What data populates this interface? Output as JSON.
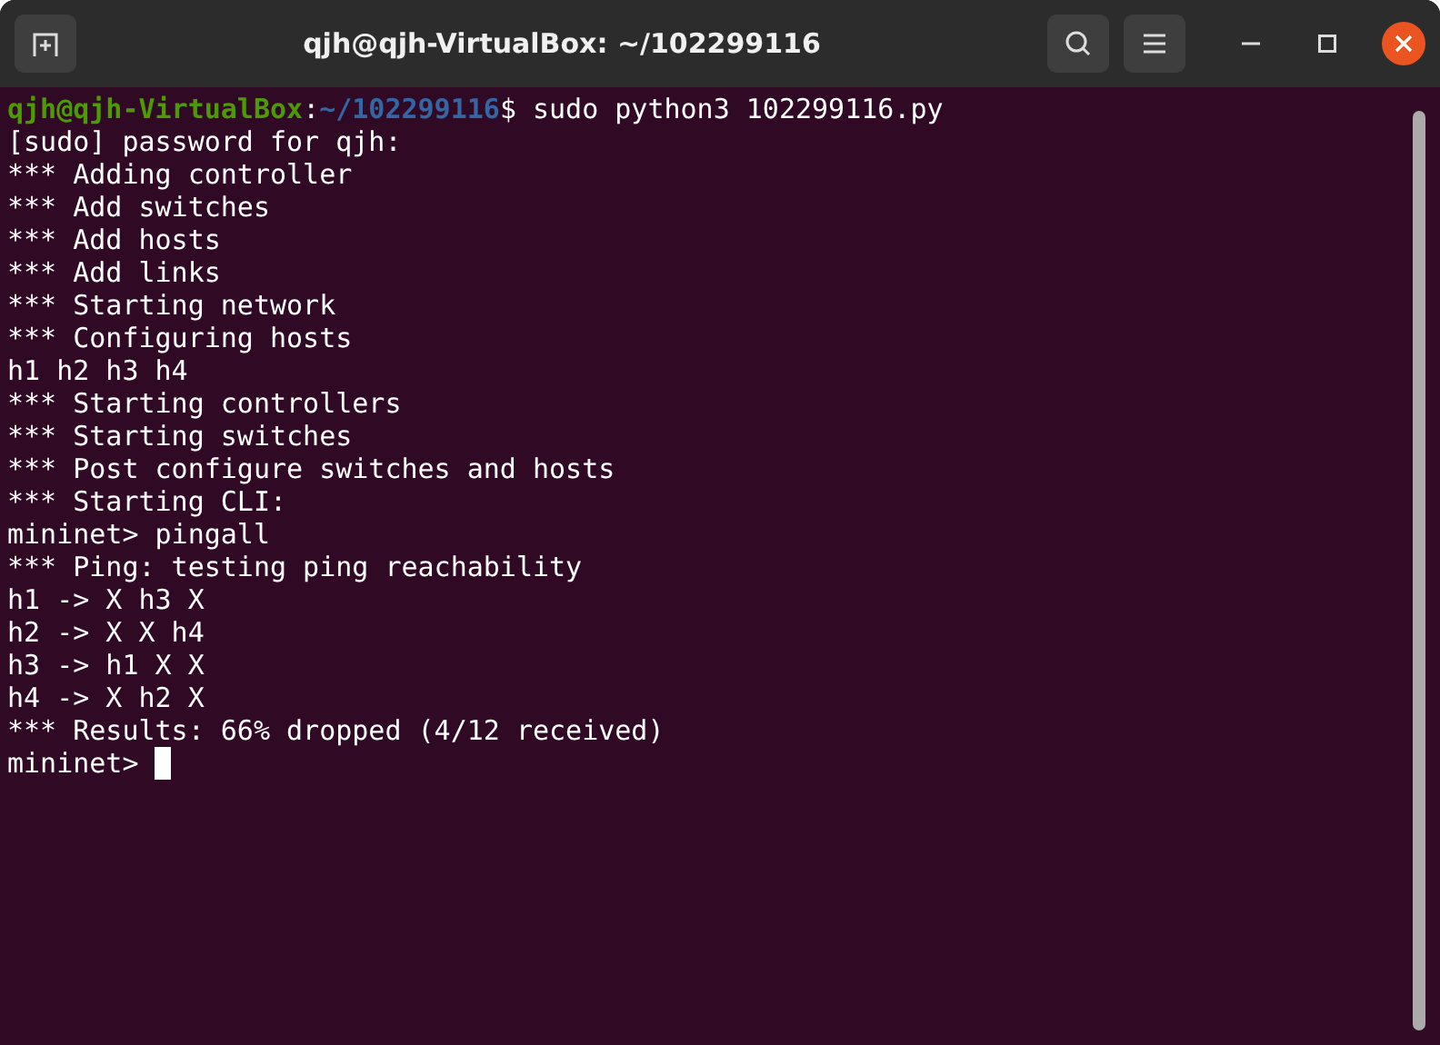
{
  "window": {
    "title": "qjh@qjh-VirtualBox: ~/102299116"
  },
  "terminal": {
    "lines": [
      {
        "kind": "prompt",
        "user_host": "qjh@qjh-VirtualBox",
        "separator": ":",
        "path": "~/102299116",
        "command": "$ sudo python3 102299116.py"
      },
      {
        "kind": "output",
        "text": "[sudo] password for qjh:"
      },
      {
        "kind": "output",
        "text": "*** Adding controller"
      },
      {
        "kind": "output",
        "text": "*** Add switches"
      },
      {
        "kind": "output",
        "text": "*** Add hosts"
      },
      {
        "kind": "output",
        "text": "*** Add links"
      },
      {
        "kind": "output",
        "text": "*** Starting network"
      },
      {
        "kind": "output",
        "text": "*** Configuring hosts"
      },
      {
        "kind": "output",
        "text": "h1 h2 h3 h4"
      },
      {
        "kind": "output",
        "text": "*** Starting controllers"
      },
      {
        "kind": "output",
        "text": "*** Starting switches"
      },
      {
        "kind": "output",
        "text": "*** Post configure switches and hosts"
      },
      {
        "kind": "output",
        "text": "*** Starting CLI:"
      },
      {
        "kind": "output",
        "text": "mininet> pingall"
      },
      {
        "kind": "output",
        "text": "*** Ping: testing ping reachability"
      },
      {
        "kind": "output",
        "text": "h1 -> X h3 X"
      },
      {
        "kind": "output",
        "text": "h2 -> X X h4"
      },
      {
        "kind": "output",
        "text": "h3 -> h1 X X"
      },
      {
        "kind": "output",
        "text": "h4 -> X h2 X"
      },
      {
        "kind": "output",
        "text": "*** Results: 66% dropped (4/12 received)"
      },
      {
        "kind": "cursor",
        "text": "mininet>"
      }
    ]
  }
}
